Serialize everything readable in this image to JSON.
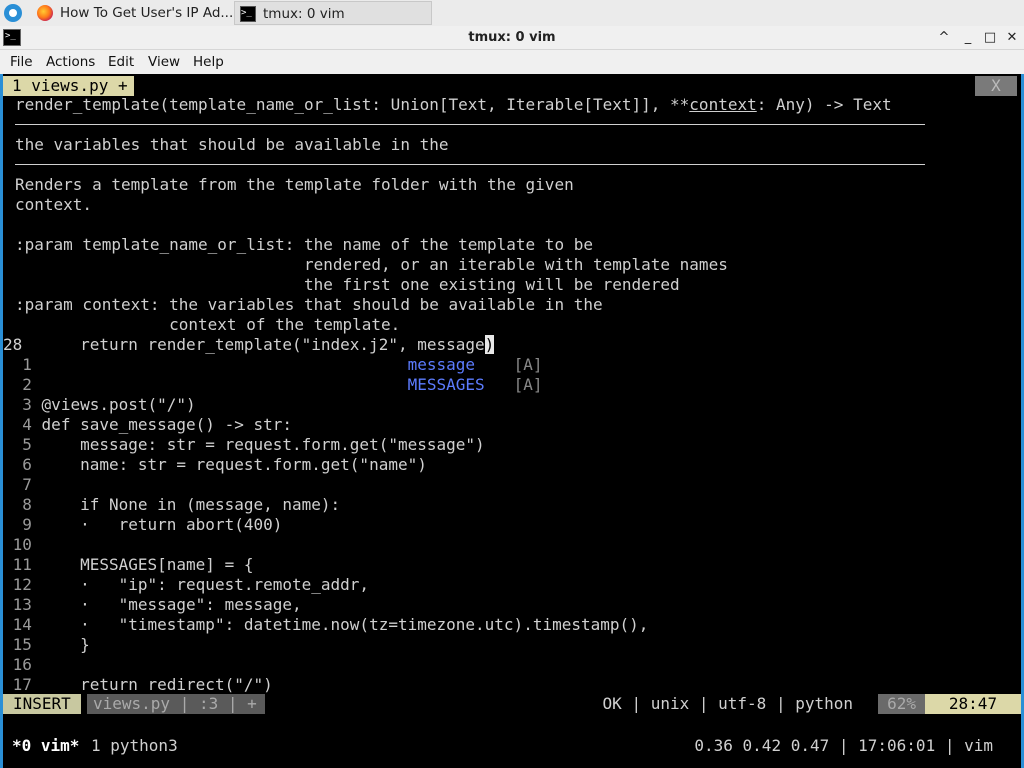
{
  "taskbar": {
    "tasks": [
      {
        "label": "How To Get User's IP Ad...",
        "icon": "firefox-icon"
      },
      {
        "label": "tmux: 0 vim",
        "icon": "terminal-icon"
      }
    ]
  },
  "window": {
    "title": "tmux: 0 vim",
    "controls": [
      "^",
      "_",
      "□",
      "✕"
    ]
  },
  "menu": [
    "File",
    "Actions",
    "Edit",
    "View",
    "Help"
  ],
  "vim": {
    "tab_label": "1 views.py +",
    "tab_close": "X",
    "signature": "render_template(template_name_or_list: Union[Text, Iterable[Text]], **",
    "signature_param": "context",
    "signature_tail": ": Any) -> Text",
    "hint_line": "the variables that should be available in the",
    "doc": [
      "Renders a template from the template folder with the given",
      "context.",
      "",
      ":param template_name_or_list: the name of the template to be",
      "                              rendered, or an iterable with template names",
      "                              the first one existing will be rendered",
      ":param context: the variables that should be available in the",
      "                context of the template."
    ],
    "current_line": {
      "num": "28",
      "before": "    return render_template",
      "paren_open": "(",
      "args": "\"index.j2\", message",
      "paren_close": ")"
    },
    "popup": [
      {
        "num": "1",
        "word": "message",
        "kind": "[A]"
      },
      {
        "num": "2",
        "word": "MESSAGES",
        "kind": "[A]"
      }
    ],
    "code_lines": [
      {
        "num": "3",
        "text": "@views.post(\"/\")"
      },
      {
        "num": "4",
        "text": "def save_message() -> str:"
      },
      {
        "num": "5",
        "text": "    message: str = request.form.get(\"message\")"
      },
      {
        "num": "6",
        "text": "    name: str = request.form.get(\"name\")"
      },
      {
        "num": "7",
        "text": ""
      },
      {
        "num": "8",
        "text": "    if None in (message, name):"
      },
      {
        "num": "9",
        "text": "    ·   return abort(400)"
      },
      {
        "num": "10",
        "text": ""
      },
      {
        "num": "11",
        "text": "    MESSAGES[name] = {"
      },
      {
        "num": "12",
        "text": "    ·   \"ip\": request.remote_addr,"
      },
      {
        "num": "13",
        "text": "    ·   \"message\": message,"
      },
      {
        "num": "14",
        "text": "    ·   \"timestamp\": datetime.now(tz=timezone.utc).timestamp(),"
      },
      {
        "num": "15",
        "text": "    }"
      },
      {
        "num": "16",
        "text": ""
      },
      {
        "num": "17",
        "text": "    return redirect(\"/\")"
      }
    ],
    "status": {
      "mode": "INSERT",
      "file": "views.py | :3 | +",
      "right": "OK | unix | utf-8 | python",
      "percent": "62%",
      "position": "28:47"
    }
  },
  "tmux": {
    "active_window": "*0 vim*",
    "other_window": "1 python3",
    "right": "0.36 0.42 0.47 | 17:06:01 | vim"
  }
}
